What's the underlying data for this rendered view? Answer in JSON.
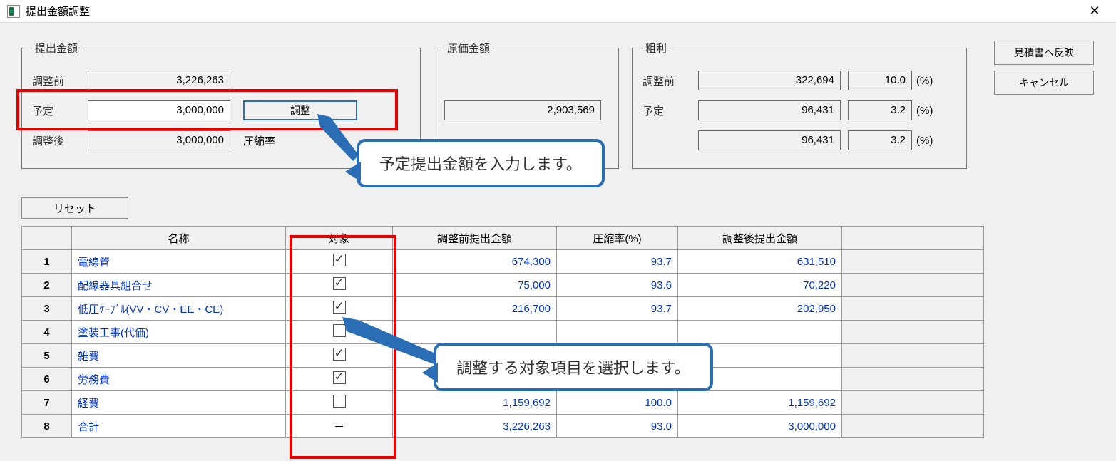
{
  "window": {
    "title": "提出金額調整"
  },
  "submission": {
    "legend": "提出金額",
    "before_label": "調整前",
    "before_value": "3,226,263",
    "plan_label": "予定",
    "plan_value": "3,000,000",
    "adjust_btn": "調整",
    "after_label": "調整後",
    "after_value": "3,000,000",
    "compress_label": "圧縮率"
  },
  "cost": {
    "legend": "原価金額",
    "value": "2,903,569"
  },
  "profit": {
    "legend": "粗利",
    "before_label": "調整前",
    "before_amount": "322,694",
    "before_pct": "10.0",
    "plan_label": "予定",
    "plan_amount": "96,431",
    "plan_pct": "3.2",
    "after_amount": "96,431",
    "after_pct": "3.2",
    "pct_unit": "(%)"
  },
  "buttons": {
    "reflect": "見積書へ反映",
    "cancel": "キャンセル",
    "reset": "リセット"
  },
  "callouts": {
    "c1": "予定提出金額を入力します。",
    "c2": "調整する対象項目を選択します。"
  },
  "table": {
    "headers": {
      "name": "名称",
      "target": "対象",
      "before": "調整前提出金額",
      "rate": "圧縮率(%)",
      "after": "調整後提出金額"
    },
    "rows": [
      {
        "no": "1",
        "name": "電線管",
        "target": "checked",
        "before": "674,300",
        "rate": "93.7",
        "after": "631,510"
      },
      {
        "no": "2",
        "name": "配線器具組合せ",
        "target": "checked",
        "before": "75,000",
        "rate": "93.6",
        "after": "70,220"
      },
      {
        "no": "3",
        "name": "低圧ｹｰﾌﾞﾙ(VV・CV・EE・CE)",
        "target": "checked",
        "before": "216,700",
        "rate": "93.7",
        "after": "202,950"
      },
      {
        "no": "4",
        "name": "塗装工事(代価)",
        "target": "unchecked",
        "before": "",
        "rate": "",
        "after": ""
      },
      {
        "no": "5",
        "name": "雑費",
        "target": "checked",
        "before": "",
        "rate": "",
        "after": ""
      },
      {
        "no": "6",
        "name": "労務費",
        "target": "checked",
        "before": "",
        "rate": "",
        "after": ""
      },
      {
        "no": "7",
        "name": "経費",
        "target": "unchecked",
        "before": "1,159,692",
        "rate": "100.0",
        "after": "1,159,692"
      },
      {
        "no": "8",
        "name": "合計",
        "target": "dash",
        "before": "3,226,263",
        "rate": "93.0",
        "after": "3,000,000"
      }
    ]
  }
}
